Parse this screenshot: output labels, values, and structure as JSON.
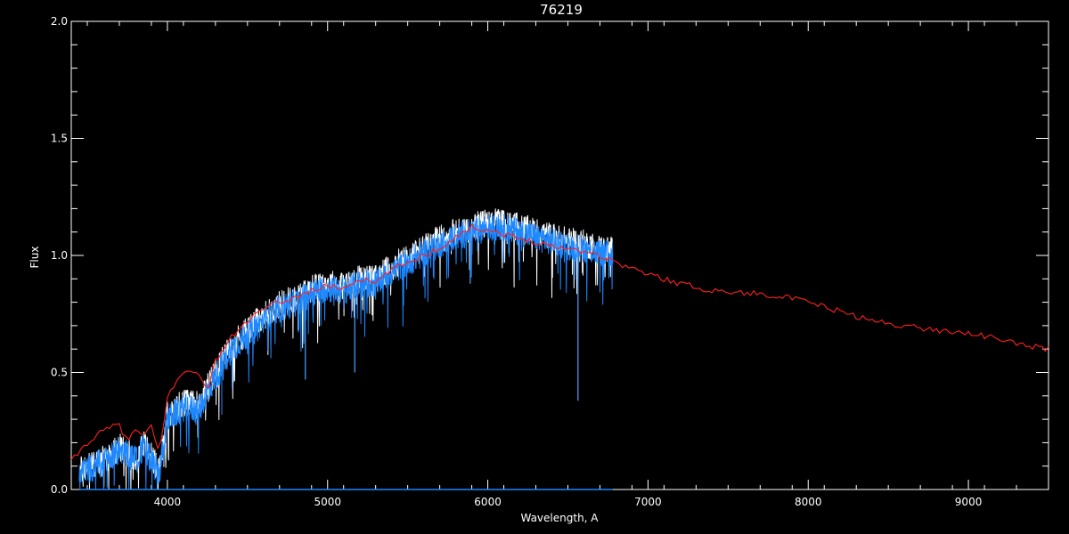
{
  "chart_data": {
    "type": "line",
    "title": "76219",
    "xlabel": "Wavelength, A",
    "ylabel": "Flux",
    "xlim": [
      3400,
      9500
    ],
    "ylim": [
      0,
      2.0
    ],
    "x_ticks": [
      4000,
      5000,
      6000,
      7000,
      8000,
      9000
    ],
    "x_tick_labels": [
      "4000",
      "5000",
      "6000",
      "7000",
      "8000",
      "9000"
    ],
    "y_ticks": [
      0,
      0.5,
      1.0,
      1.5,
      2.0
    ],
    "y_tick_labels": [
      "0.0",
      "0.5",
      "1.0",
      "1.5",
      "2.0"
    ],
    "grid": false,
    "legend": "none",
    "background_color": "#000000",
    "axis_color": "#ffffff",
    "series": [
      {
        "color": "#ffffff",
        "style": "noisy",
        "x": [
          3450,
          3550,
          3650,
          3700,
          3800,
          3850,
          3900,
          3950,
          4000,
          4100,
          4200,
          4250,
          4300,
          4400,
          4500,
          4600,
          4700,
          4800,
          4900,
          5000,
          5100,
          5200,
          5300,
          5400,
          5500,
          5600,
          5700,
          5800,
          5900,
          6000,
          6100,
          6200,
          6300,
          6400,
          6500,
          6600,
          6700,
          6780
        ],
        "y": [
          0.08,
          0.11,
          0.15,
          0.18,
          0.14,
          0.2,
          0.14,
          0.08,
          0.32,
          0.37,
          0.36,
          0.44,
          0.5,
          0.62,
          0.68,
          0.74,
          0.79,
          0.82,
          0.86,
          0.88,
          0.87,
          0.9,
          0.9,
          0.95,
          0.99,
          1.03,
          1.07,
          1.1,
          1.12,
          1.14,
          1.14,
          1.12,
          1.1,
          1.08,
          1.06,
          1.05,
          1.03,
          1.02
        ]
      },
      {
        "color": "#1e88ff",
        "style": "noisy",
        "x": [
          3450,
          3550,
          3650,
          3700,
          3800,
          3850,
          3900,
          3950,
          4000,
          4100,
          4200,
          4250,
          4300,
          4400,
          4500,
          4600,
          4700,
          4800,
          4900,
          5000,
          5100,
          5200,
          5300,
          5400,
          5500,
          5600,
          5700,
          5800,
          5900,
          6000,
          6100,
          6200,
          6300,
          6400,
          6500,
          6600,
          6700,
          6780
        ],
        "y": [
          0.07,
          0.1,
          0.14,
          0.17,
          0.13,
          0.18,
          0.12,
          0.07,
          0.3,
          0.35,
          0.34,
          0.42,
          0.48,
          0.6,
          0.66,
          0.72,
          0.77,
          0.8,
          0.84,
          0.86,
          0.85,
          0.88,
          0.88,
          0.93,
          0.97,
          1.01,
          1.05,
          1.08,
          1.1,
          1.12,
          1.12,
          1.1,
          1.08,
          1.06,
          1.04,
          1.03,
          1.01,
          1.0
        ]
      },
      {
        "color": "#ff2020",
        "style": "smooth",
        "x": [
          3400,
          3500,
          3600,
          3700,
          3750,
          3800,
          3850,
          3900,
          3950,
          4000,
          4050,
          4100,
          4150,
          4200,
          4250,
          4300,
          4400,
          4500,
          4600,
          4700,
          4800,
          4900,
          5000,
          5100,
          5200,
          5300,
          5400,
          5500,
          5600,
          5700,
          5800,
          5900,
          6000,
          6100,
          6200,
          6300,
          6400,
          6500,
          6600,
          6700,
          6800,
          7000,
          7200,
          7400,
          7600,
          7800,
          8000,
          8200,
          8400,
          8600,
          8800,
          9000,
          9200,
          9400,
          9500
        ],
        "y": [
          0.12,
          0.2,
          0.25,
          0.28,
          0.2,
          0.26,
          0.22,
          0.27,
          0.15,
          0.4,
          0.45,
          0.5,
          0.52,
          0.48,
          0.42,
          0.55,
          0.65,
          0.72,
          0.77,
          0.8,
          0.82,
          0.85,
          0.87,
          0.86,
          0.9,
          0.88,
          0.94,
          0.97,
          1.0,
          1.03,
          1.08,
          1.12,
          1.11,
          1.09,
          1.07,
          1.06,
          1.04,
          1.03,
          1.02,
          1.0,
          0.97,
          0.92,
          0.88,
          0.85,
          0.84,
          0.83,
          0.8,
          0.76,
          0.72,
          0.7,
          0.68,
          0.67,
          0.64,
          0.61,
          0.6
        ]
      },
      {
        "color": "#1e88ff",
        "style": "flat",
        "x": [
          3450,
          6780
        ],
        "y": [
          0.0,
          0.0
        ]
      }
    ]
  }
}
